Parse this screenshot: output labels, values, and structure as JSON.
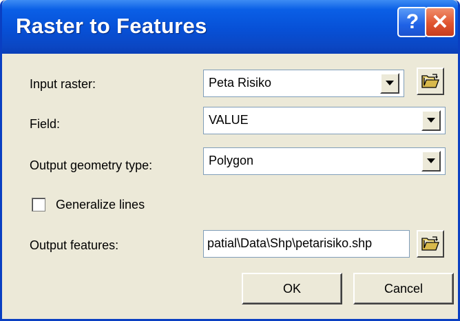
{
  "window": {
    "title": "Raster to Features"
  },
  "titlebar_buttons": {
    "help": "?",
    "close": "✕"
  },
  "fields": {
    "input_raster": {
      "label": "Input raster:",
      "value": "Peta Risiko"
    },
    "field": {
      "label": "Field:",
      "value": "VALUE"
    },
    "geometry": {
      "label": "Output geometry type:",
      "value": "Polygon"
    },
    "generalize": {
      "label": "Generalize lines",
      "checked": false
    },
    "output": {
      "label": "Output features:",
      "value": "patial\\Data\\Shp\\petarisiko.shp"
    }
  },
  "buttons": {
    "ok": "OK",
    "cancel": "Cancel"
  },
  "colors": {
    "title_bar": "#0750d6",
    "dialog_bg": "#ece9d8",
    "close_red": "#e0552f"
  }
}
